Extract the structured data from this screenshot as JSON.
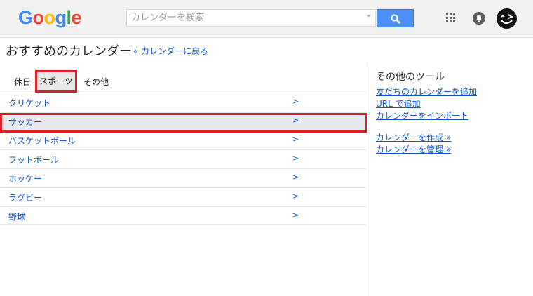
{
  "header": {
    "logo_text": "Google",
    "search_placeholder": "カレンダーを検索"
  },
  "page": {
    "title": "おすすめのカレンダー",
    "back_link": "« カレンダーに戻る"
  },
  "tabs": [
    {
      "label": "休日",
      "selected": false
    },
    {
      "label": "スポーツ",
      "selected": true
    },
    {
      "label": "その他",
      "selected": false
    }
  ],
  "sports_list": [
    {
      "label": "クリケット",
      "arrow": ">"
    },
    {
      "label": "サッカー",
      "arrow": ">",
      "highlighted": true
    },
    {
      "label": "バスケットボール",
      "arrow": ">"
    },
    {
      "label": "フットボール",
      "arrow": ">"
    },
    {
      "label": "ホッケー",
      "arrow": ">"
    },
    {
      "label": "ラグビー",
      "arrow": ">"
    },
    {
      "label": "野球",
      "arrow": ">"
    }
  ],
  "side": {
    "title": "その他のツール",
    "links": [
      "友だちのカレンダーを追加",
      "URL で追加",
      "カレンダーをインポート",
      "カレンダーを作成 »",
      "カレンダーを管理 »"
    ]
  },
  "colors": {
    "accent": "#4d90fe",
    "link": "#1155cc",
    "highlight_border": "#d6232a"
  }
}
